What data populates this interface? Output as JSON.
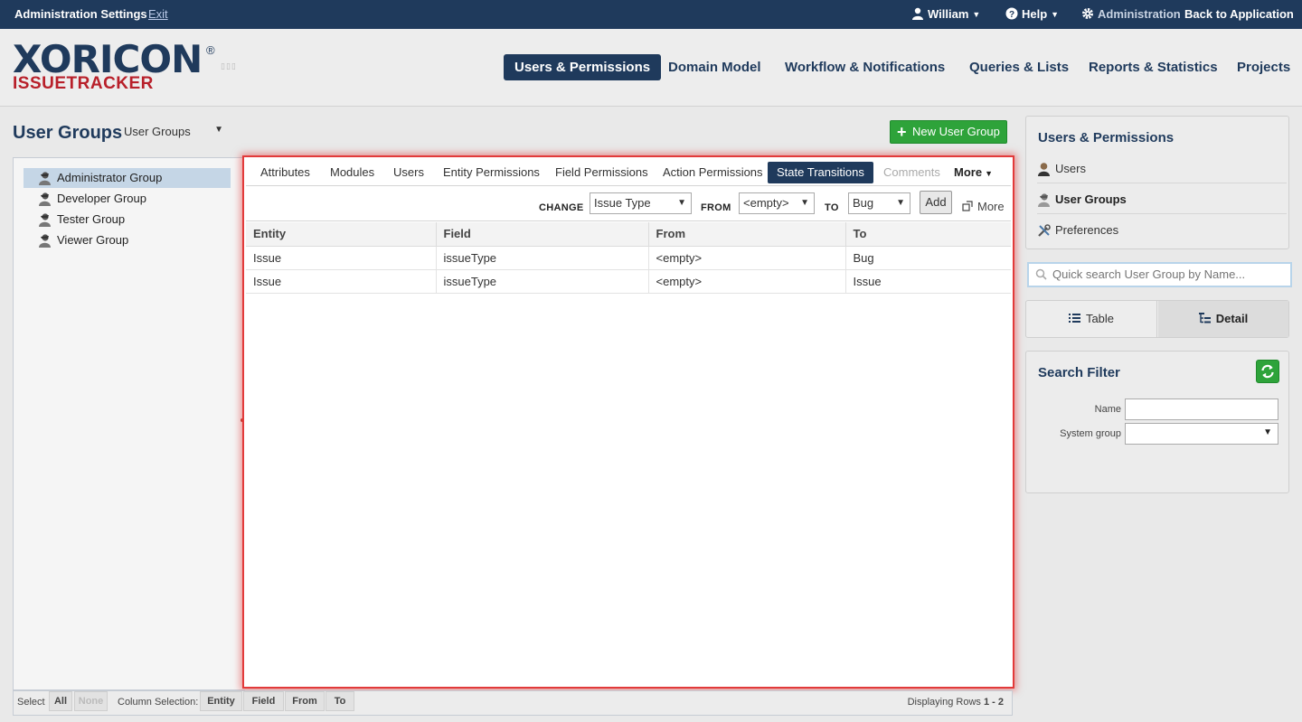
{
  "topbar": {
    "title": "Administration Settings",
    "exit_label": "Exit",
    "user_label": "William",
    "help_label": "Help",
    "admin_label": "Administration",
    "back_label": "Back to Application"
  },
  "logo": {
    "main": "XORICON",
    "sub": "ISSUETRACKER",
    "reg": "®"
  },
  "nav": {
    "items": [
      {
        "label": "Users & Permissions"
      },
      {
        "label": "Domain Model"
      },
      {
        "label": "Workflow & Notifications"
      },
      {
        "label": "Queries & Lists"
      },
      {
        "label": "Reports & Statistics"
      },
      {
        "label": "Projects"
      }
    ],
    "active": "Users & Permissions"
  },
  "page": {
    "title": "User Groups",
    "group_select": "User Groups",
    "new_button": "New User Group"
  },
  "groups": {
    "items": [
      {
        "label": "Administrator Group",
        "selected": true
      },
      {
        "label": "Developer Group"
      },
      {
        "label": "Tester Group"
      },
      {
        "label": "Viewer Group"
      }
    ]
  },
  "tabs": {
    "items": [
      {
        "label": "Attributes"
      },
      {
        "label": "Modules"
      },
      {
        "label": "Users"
      },
      {
        "label": "Entity Permissions"
      },
      {
        "label": "Field Permissions"
      },
      {
        "label": "Action Permissions"
      },
      {
        "label": "State Transitions"
      },
      {
        "label": "Comments"
      },
      {
        "label": "More"
      }
    ],
    "active": "State Transitions"
  },
  "toolbar": {
    "change_label": "CHANGE",
    "change_value": "Issue Type",
    "from_label": "FROM",
    "from_value": "<empty>",
    "to_label": "TO",
    "to_value": "Bug",
    "add_label": "Add",
    "more_label": "More"
  },
  "table": {
    "columns": [
      "Entity",
      "Field",
      "From",
      "To"
    ],
    "rows": [
      [
        "Issue",
        "issueType",
        "<empty>",
        "Bug"
      ],
      [
        "Issue",
        "issueType",
        "<empty>",
        "Issue"
      ]
    ]
  },
  "bottombar": {
    "select_label": "Select",
    "all_label": "All",
    "none_label": "None",
    "colsel_label": "Column Selection:",
    "col_buttons": [
      "Entity",
      "Field",
      "From",
      "To"
    ],
    "displaying_label": "Displaying Rows",
    "displaying_range": "1 - 2"
  },
  "sidebar": {
    "title": "Users & Permissions",
    "links": [
      {
        "label": "Users"
      },
      {
        "label": "User Groups"
      },
      {
        "label": "Preferences"
      }
    ],
    "search_placeholder": "Quick search User Group by Name...",
    "view_table": "Table",
    "view_detail": "Detail",
    "filter_title": "Search Filter",
    "filter_name_label": "Name",
    "filter_system_label": "System group"
  },
  "colors": {
    "primary": "#1f3a5c",
    "accent_red": "#b8202a",
    "green": "#2ea33a",
    "highlight_border": "#e23a3a"
  }
}
